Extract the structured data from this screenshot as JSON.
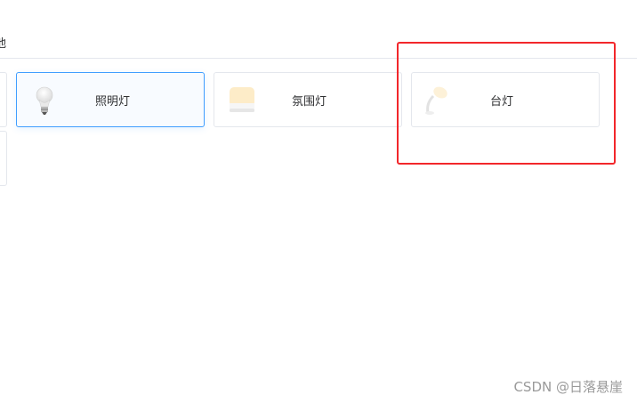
{
  "tab": {
    "label": "他"
  },
  "cards": [
    {
      "label": "",
      "icon": "partial-card"
    },
    {
      "label": "照明灯",
      "icon": "light-bulb-icon",
      "selected": true
    },
    {
      "label": "氛围灯",
      "icon": "ambient-lamp-icon",
      "selected": false
    },
    {
      "label": "台灯",
      "icon": "desk-lamp-icon",
      "selected": false
    },
    {
      "label": "",
      "icon": "partial-card"
    }
  ],
  "watermark": "CSDN @日落悬崖",
  "colors": {
    "accent": "#409eff",
    "highlight": "#f2272b"
  }
}
